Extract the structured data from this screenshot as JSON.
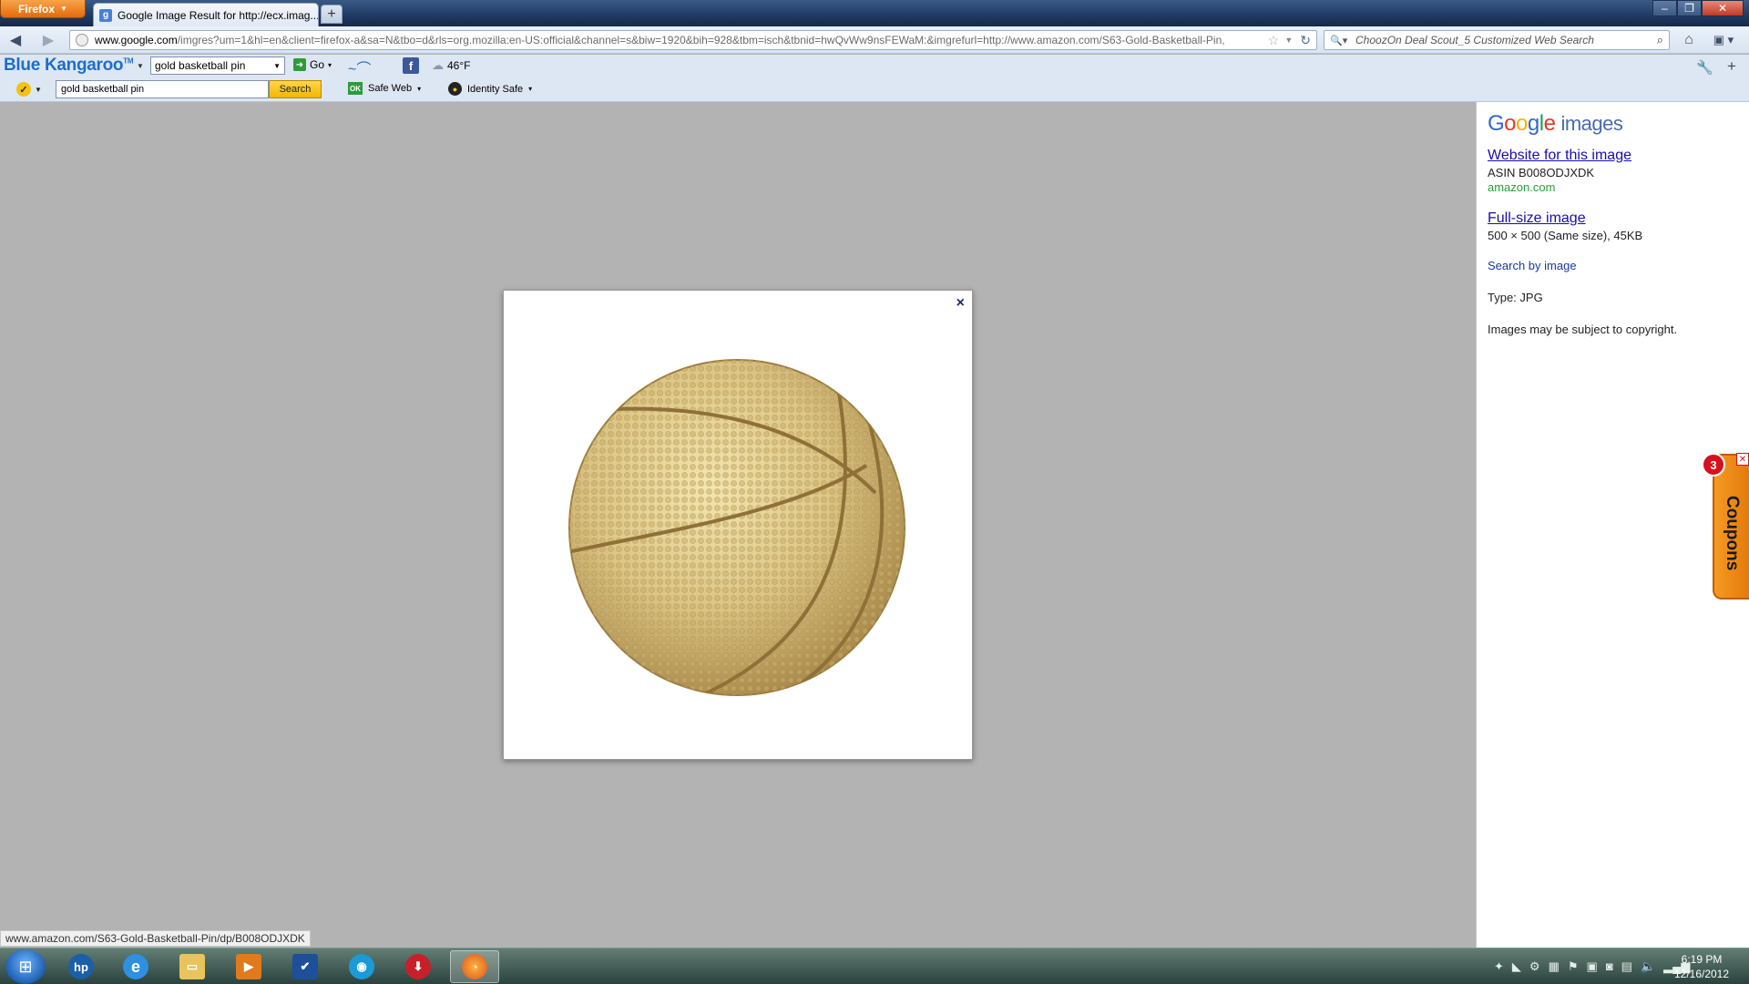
{
  "browser": {
    "menu_button": "Firefox",
    "tab_title": "Google Image Result for http://ecx.imag...",
    "url_domain": "www.google.com",
    "url_rest": "/imgres?um=1&hl=en&client=firefox-a&sa=N&tbo=d&rls=org.mozilla:en-US:official&channel=s&biw=1920&bih=928&tbm=isch&tbnid=hwQvWw9nsFEWaM:&imgrefurl=http://www.amazon.com/S63-Gold-Basketball-Pin,",
    "search_placeholder": "ChoozOn Deal Scout_5 Customized Web Search"
  },
  "toolbar": {
    "brand": "Blue Kangaroo",
    "brand_tm": "TM",
    "select_value": "gold basketball pin",
    "go_label": "Go",
    "weather": "46°F",
    "norton_input": "gold basketball pin",
    "norton_search": "Search",
    "safe_web": "Safe Web",
    "identity_safe": "Identity Safe"
  },
  "viewer": {
    "close": "×"
  },
  "sidepanel": {
    "logo_letters": [
      "G",
      "o",
      "o",
      "g",
      "l",
      "e"
    ],
    "logo_suffix": "images",
    "website_link": "Website for this image",
    "asin": "ASIN B008ODJXDK",
    "domain": "amazon.com",
    "fullsize_link": "Full-size image",
    "dimensions": "500 × 500 (Same size), 45KB",
    "search_by_image": "Search by image",
    "type": "Type:  JPG",
    "copyright": "Images may be subject to copyright."
  },
  "coupons": {
    "label": "Coupons",
    "badge": "3"
  },
  "status_bar": "www.amazon.com/S63-Gold-Basketball-Pin/dp/B008ODJXDK",
  "taskbar": {
    "time": "6:19 PM",
    "date": "12/16/2012"
  },
  "colors": {
    "accent_blue": "#1d6dcf",
    "link": "#1a0dab",
    "green_url": "#2a9d3a",
    "coupon_orange": "#f59a24"
  }
}
